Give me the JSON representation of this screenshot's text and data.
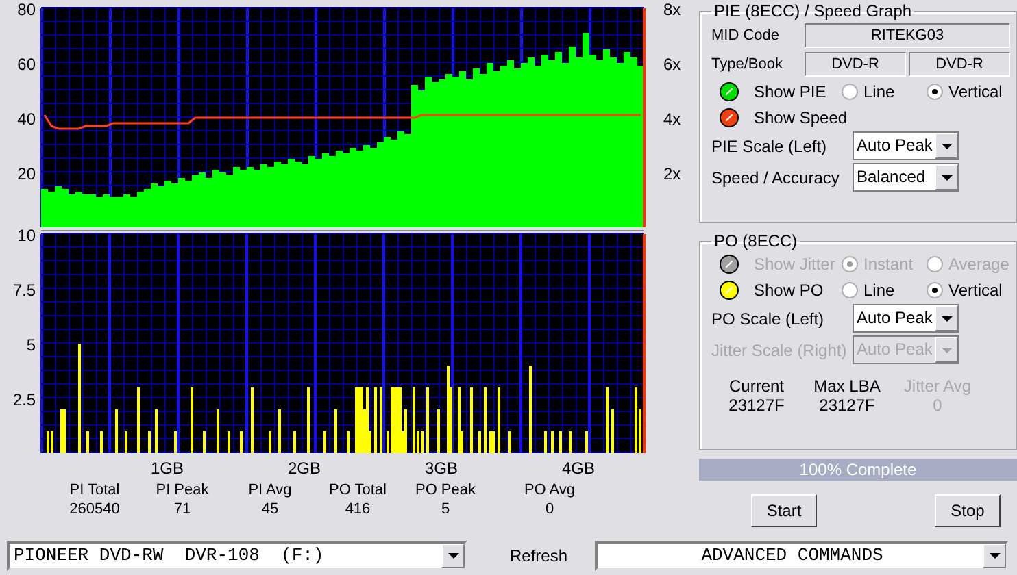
{
  "pie_chart": {
    "chart_data": {
      "type": "bar",
      "grid": true,
      "ylim": [
        0,
        80
      ],
      "yticks": [
        20,
        40,
        60,
        80
      ],
      "series": [
        {
          "color": "#00ff00",
          "values": [
            14,
            13,
            15,
            14,
            12,
            13,
            12,
            12,
            11,
            12,
            11,
            11,
            12,
            11,
            13,
            14,
            16,
            15,
            17,
            16,
            18,
            17,
            19,
            20,
            18,
            21,
            20,
            19,
            22,
            21,
            22,
            21,
            23,
            22,
            24,
            23,
            25,
            24,
            23,
            26,
            25,
            27,
            26,
            28,
            27,
            29,
            28,
            30,
            29,
            31,
            33,
            32,
            35,
            34,
            52,
            50,
            55,
            53,
            54,
            56,
            55,
            57,
            54,
            58,
            56,
            60,
            57,
            59,
            61,
            58,
            60,
            62,
            59,
            63,
            61,
            64,
            60,
            66,
            62,
            71,
            63,
            61,
            65,
            62,
            60,
            64,
            62,
            59
          ]
        }
      ]
    }
  },
  "speed_chart": {
    "chart_data": {
      "type": "line",
      "ylim": [
        0,
        8
      ],
      "yticks": [
        {
          "value": 2,
          "label": "2x"
        },
        {
          "value": 4,
          "label": "4x"
        },
        {
          "value": 6,
          "label": "6x"
        },
        {
          "value": 8,
          "label": "8x"
        }
      ],
      "series": [
        {
          "color": "#ff4010",
          "values": [
            4.1,
            3.7,
            3.6,
            3.6,
            3.6,
            3.6,
            3.7,
            3.7,
            3.7,
            3.7,
            3.8,
            3.8,
            3.8,
            3.8,
            3.8,
            3.8,
            3.8,
            3.8,
            3.8,
            3.8,
            3.8,
            3.8,
            4.0,
            4.0,
            4.0,
            4.0,
            4.0,
            4.0,
            4.0,
            4.0,
            4.0,
            4.0,
            4.0,
            4.0,
            4.0,
            4.0,
            4.0,
            4.0,
            4.0,
            4.0,
            4.0,
            4.0,
            4.0,
            4.0,
            4.0,
            4.0,
            4.0,
            4.0,
            4.0,
            4.0,
            4.0,
            4.0,
            4.0,
            4.0,
            4.0,
            4.1,
            4.1,
            4.1,
            4.1,
            4.1,
            4.1,
            4.1,
            4.1,
            4.1,
            4.1,
            4.1,
            4.1,
            4.1,
            4.1,
            4.1,
            4.1,
            4.1,
            4.1,
            4.1,
            4.1,
            4.1,
            4.1,
            4.1,
            4.1,
            4.1,
            4.1,
            4.1,
            4.1,
            4.1,
            4.1,
            4.1,
            4.1,
            4.1
          ]
        }
      ]
    }
  },
  "po_chart": {
    "chart_data": {
      "type": "bar",
      "grid": true,
      "ref_lines": [
        {
          "axis": "x",
          "value": 0.5
        },
        {
          "axis": "x",
          "value": 1.0
        },
        {
          "axis": "x",
          "value": 1.5
        },
        {
          "axis": "x",
          "value": 2.0
        },
        {
          "axis": "x",
          "value": 2.5
        },
        {
          "axis": "x",
          "value": 3.0
        },
        {
          "axis": "x",
          "value": 3.5
        },
        {
          "axis": "x",
          "value": 4.0
        }
      ],
      "xlim": [
        0,
        4.4
      ],
      "ylim": [
        0,
        10
      ],
      "yticks": [
        {
          "value": 2.5,
          "label": "2.5"
        },
        {
          "value": 5,
          "label": "5"
        },
        {
          "value": 7.5,
          "label": "7.5"
        },
        {
          "value": 10,
          "label": "10"
        }
      ],
      "xticks": [
        {
          "value": 0.92,
          "label": "1GB"
        },
        {
          "value": 1.92,
          "label": "2GB"
        },
        {
          "value": 2.92,
          "label": "3GB"
        },
        {
          "value": 3.92,
          "label": "4GB"
        }
      ],
      "series": [
        {
          "color": "#ffff00",
          "x": [
            0.04,
            0.07,
            0.14,
            0.16,
            0.27,
            0.33,
            0.43,
            0.54,
            0.61,
            0.7,
            0.78,
            0.83,
            0.97,
            1.09,
            1.18,
            1.28,
            1.36,
            1.45,
            1.53,
            1.66,
            1.73,
            1.84,
            1.94,
            2.06,
            2.14,
            2.23,
            2.29,
            2.31,
            2.33,
            2.35,
            2.37,
            2.39,
            2.43,
            2.47,
            2.52,
            2.55,
            2.57,
            2.59,
            2.61,
            2.63,
            2.65,
            2.71,
            2.74,
            2.77,
            2.81,
            2.89,
            2.96,
            2.98,
            3.04,
            3.06,
            3.13,
            3.19,
            3.23,
            3.27,
            3.29,
            3.33,
            3.41,
            3.56,
            3.67,
            3.72,
            3.78,
            3.85,
            3.97,
            4.12,
            4.16,
            4.33,
            4.36
          ],
          "values": [
            1,
            1,
            2,
            2,
            5,
            1,
            1,
            2,
            1,
            3,
            1,
            2,
            1,
            3,
            1,
            2,
            1,
            1,
            3,
            1,
            2,
            1,
            3,
            1,
            2,
            1,
            3,
            3,
            3,
            2,
            3,
            1,
            3,
            3,
            1,
            3,
            3,
            3,
            3,
            1,
            2,
            3,
            1,
            1,
            3,
            2,
            4,
            3,
            3,
            1,
            3,
            1,
            3,
            1,
            1,
            3,
            1,
            4,
            1,
            1,
            1,
            1,
            1,
            3,
            2,
            3,
            2
          ]
        }
      ]
    }
  },
  "stats": [
    {
      "label": "PI Total",
      "value": "260540"
    },
    {
      "label": "PI Peak",
      "value": "71"
    },
    {
      "label": "PI Avg",
      "value": "45"
    },
    {
      "label": "PO Total",
      "value": "416"
    },
    {
      "label": "PO Peak",
      "value": "5"
    },
    {
      "label": "PO Avg",
      "value": "0"
    }
  ],
  "pie_panel": {
    "title": "PIE (8ECC) / Speed Graph",
    "mid_label": "MID Code",
    "mid_value": "RITEKG03",
    "type_label": "Type/Book",
    "type_values": [
      "DVD-R",
      "DVD-R"
    ],
    "toggles": [
      {
        "label": "Show PIE",
        "color": "#00e000",
        "disabled": false,
        "modes": [
          {
            "label": "Line",
            "selected": false,
            "disabled": false
          },
          {
            "label": "Vertical",
            "selected": true,
            "disabled": false
          }
        ]
      },
      {
        "label": "Show Speed",
        "color": "#f04010",
        "disabled": false
      }
    ],
    "selects": [
      {
        "label": "PIE Scale (Left)",
        "value": "Auto Peak",
        "disabled": false
      },
      {
        "label": "Speed / Accuracy",
        "value": "Balanced",
        "disabled": false
      }
    ]
  },
  "po_panel": {
    "title": "PO (8ECC)",
    "toggles": [
      {
        "label": "Show Jitter",
        "color": "#a0a0a0",
        "disabled": true,
        "modes": [
          {
            "label": "Instant",
            "selected": true,
            "disabled": true
          },
          {
            "label": "Average",
            "selected": false,
            "disabled": true
          }
        ]
      },
      {
        "label": "Show PO",
        "color": "#ffff00",
        "disabled": false,
        "modes": [
          {
            "label": "Line",
            "selected": false,
            "disabled": false
          },
          {
            "label": "Vertical",
            "selected": true,
            "disabled": false
          }
        ]
      }
    ],
    "selects": [
      {
        "label": "PO Scale (Left)",
        "value": "Auto Peak",
        "disabled": false
      },
      {
        "label": "Jitter Scale (Right)",
        "value": "Auto Peak",
        "disabled": true
      }
    ],
    "readouts": [
      {
        "label": "Current",
        "value": "23127F",
        "disabled": false
      },
      {
        "label": "Max LBA",
        "value": "23127F",
        "disabled": false
      },
      {
        "label": "Jitter Avg",
        "value": "0",
        "disabled": true
      }
    ]
  },
  "progress": {
    "label": "100% Complete",
    "level": 1
  },
  "buttons": [
    {
      "label": "Start"
    },
    {
      "label": "Stop"
    }
  ],
  "drive_select": {
    "value": "PIONEER DVD-RW  DVR-108  (F:)"
  },
  "refresh": {
    "label": "Refresh"
  },
  "commands_select": {
    "value": "ADVANCED COMMANDS"
  }
}
